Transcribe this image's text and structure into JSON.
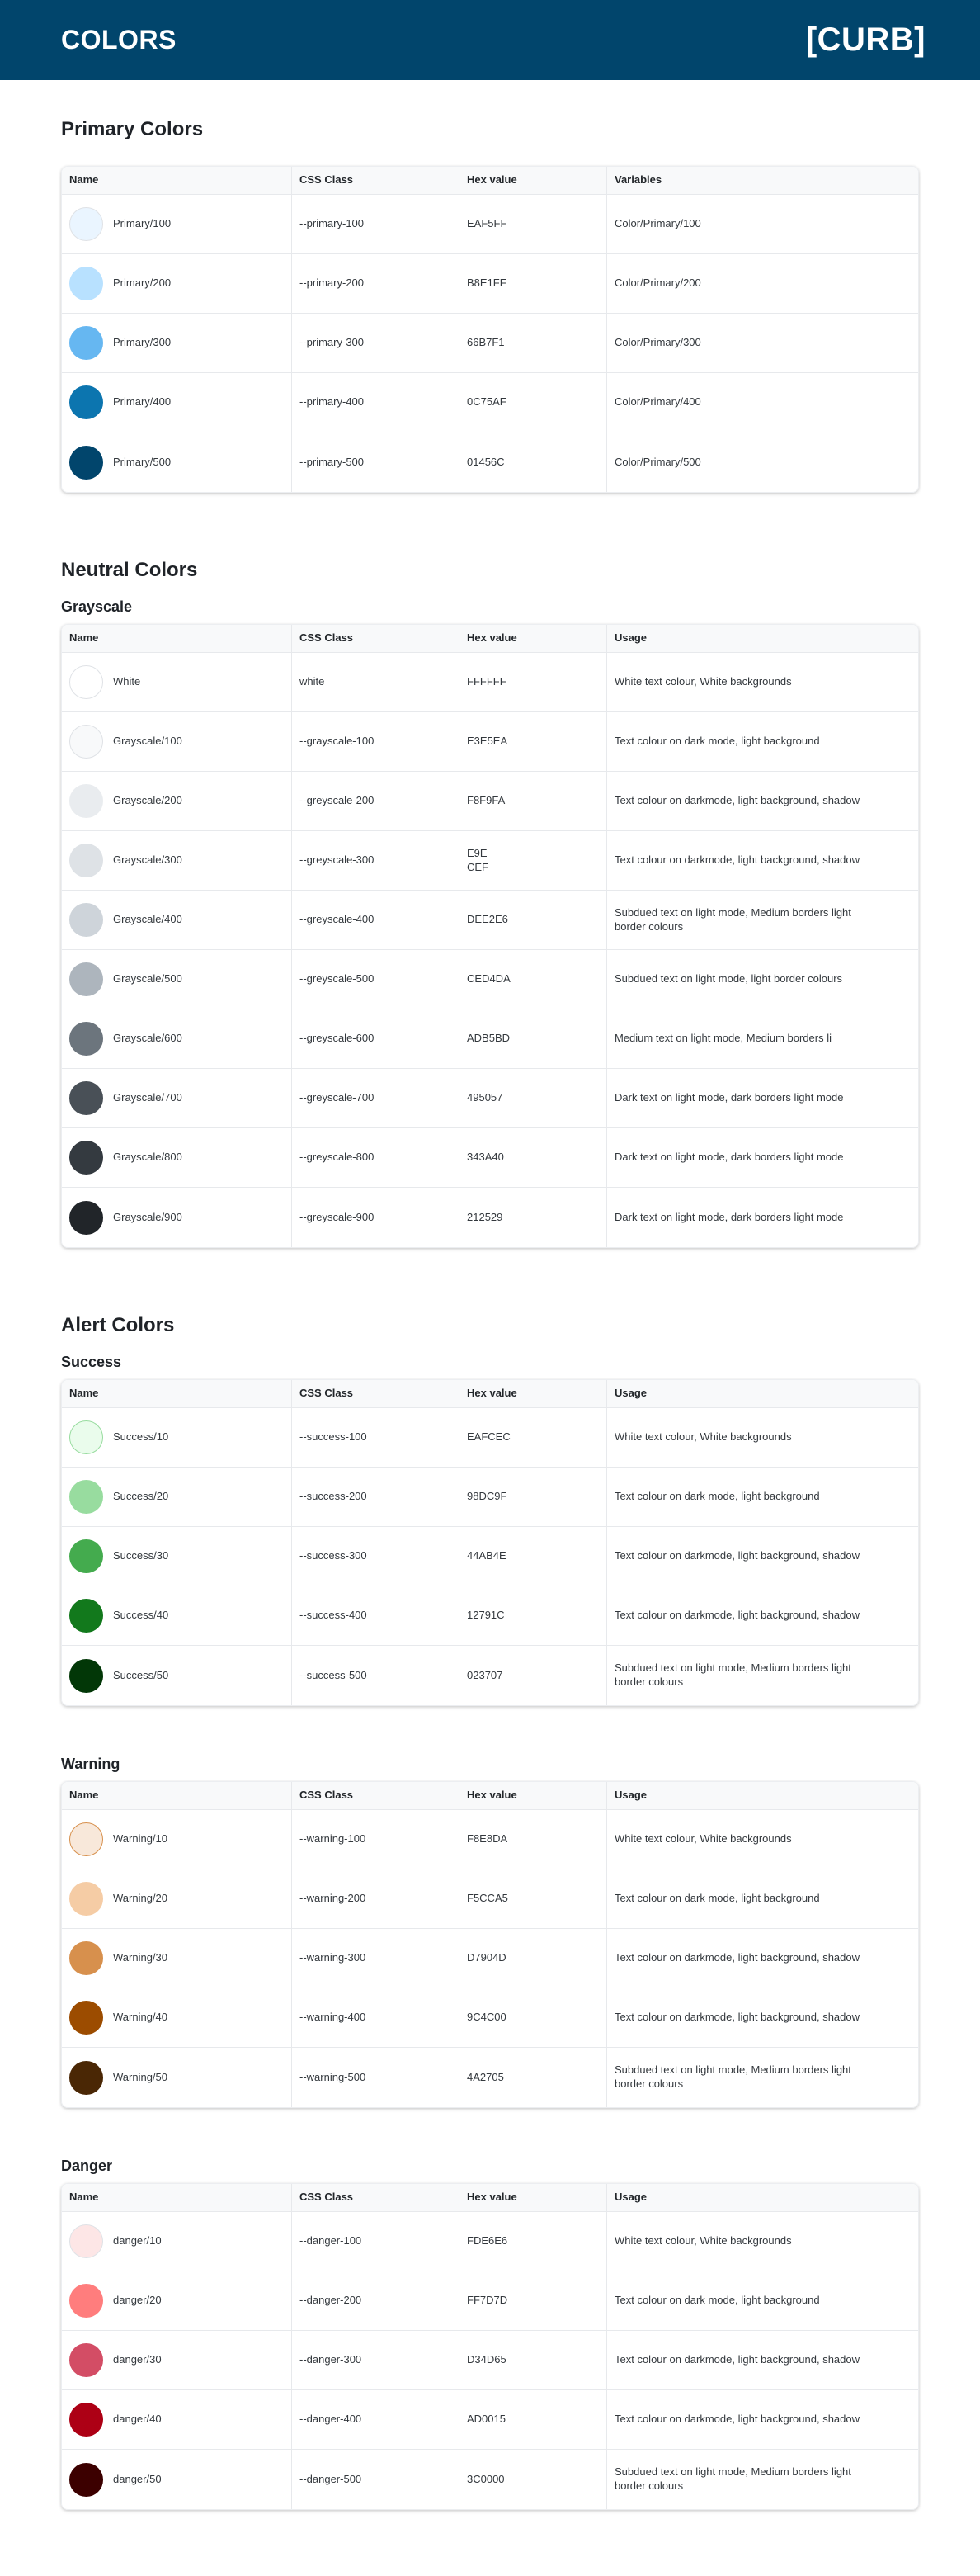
{
  "header": {
    "title": "COLORS",
    "logo": "[CURB]"
  },
  "primary": {
    "title": "Primary Colors",
    "columns": [
      "Name",
      "CSS Class",
      "Hex value",
      "Variables"
    ],
    "rows": [
      {
        "name": "Primary/100",
        "css": "--primary-100",
        "hex": "EAF5FF",
        "extra": "Color/Primary/100",
        "color": "#EAF5FF"
      },
      {
        "name": "Primary/200",
        "css": "--primary-200",
        "hex": "B8E1FF",
        "extra": "Color/Primary/200",
        "color": "#B8E1FF"
      },
      {
        "name": "Primary/300",
        "css": "--primary-300",
        "hex": "66B7F1",
        "extra": "Color/Primary/300",
        "color": "#66B7F1"
      },
      {
        "name": "Primary/400",
        "css": "--primary-400",
        "hex": "0C75AF",
        "extra": "Color/Primary/400",
        "color": "#0C75AF"
      },
      {
        "name": "Primary/500",
        "css": "--primary-500",
        "hex": "01456C",
        "extra": "Color/Primary/500",
        "color": "#01456C"
      }
    ]
  },
  "neutral": {
    "title": "Neutral Colors",
    "subtitle": "Grayscale",
    "columns": [
      "Name",
      "CSS Class",
      "Hex value",
      "Usage"
    ],
    "rows": [
      {
        "name": "White",
        "css": "white",
        "hex": "FFFFFF",
        "extra": "White text colour, White backgrounds",
        "color": "#FFFFFF"
      },
      {
        "name": "Grayscale/100",
        "css": "--grayscale-100",
        "hex": "E3E5EA",
        "extra": "Text colour on dark mode, light background",
        "color": "#F8F9FA"
      },
      {
        "name": "Grayscale/200",
        "css": "--greyscale-200",
        "hex": "F8F9FA",
        "extra": "Text colour on darkmode, light background, shadow",
        "color": "#E9ECEF"
      },
      {
        "name": "Grayscale/300",
        "css": "--greyscale-300",
        "hex": "E9E\nCEF",
        "extra": "Text colour on darkmode, light background, shadow",
        "color": "#DEE2E6"
      },
      {
        "name": "Grayscale/400",
        "css": "--greyscale-400",
        "hex": "DEE2E6",
        "extra": "Subdued text on light mode, Medium borders light border colours",
        "color": "#CED4DA"
      },
      {
        "name": "Grayscale/500",
        "css": "--greyscale-500",
        "hex": "CED4DA",
        "extra": "Subdued text on light mode, light border colours",
        "color": "#ADB5BD"
      },
      {
        "name": "Grayscale/600",
        "css": "--greyscale-600",
        "hex": "ADB5BD",
        "extra": "Medium text on light mode, Medium borders li",
        "color": "#6C757D"
      },
      {
        "name": "Grayscale/700",
        "css": "--greyscale-700",
        "hex": "495057",
        "extra": "Dark text on light mode, dark borders light mode",
        "color": "#495057"
      },
      {
        "name": "Grayscale/800",
        "css": "--greyscale-800",
        "hex": "343A40",
        "extra": "Dark text on light mode, dark borders light mode",
        "color": "#343A40"
      },
      {
        "name": "Grayscale/900",
        "css": "--greyscale-900",
        "hex": "212529",
        "extra": "Dark text on light mode, dark borders light mode",
        "color": "#212529"
      }
    ]
  },
  "alert": {
    "title": "Alert Colors",
    "success": {
      "subtitle": "Success",
      "columns": [
        "Name",
        "CSS Class",
        "Hex value",
        "Usage"
      ],
      "rows": [
        {
          "name": "Success/10",
          "css": "--success-100",
          "hex": "EAFCEC",
          "extra": "White text colour, White backgrounds",
          "color": "#EAFCEC",
          "border": "#98DC9F"
        },
        {
          "name": "Success/20",
          "css": "--success-200",
          "hex": "98DC9F",
          "extra": "Text colour on dark mode, light background",
          "color": "#98DC9F"
        },
        {
          "name": "Success/30",
          "css": "--success-300",
          "hex": "44AB4E",
          "extra": "Text colour on darkmode, light background, shadow",
          "color": "#44AB4E"
        },
        {
          "name": "Success/40",
          "css": "--success-400",
          "hex": "12791C",
          "extra": "Text colour on darkmode, light background, shadow",
          "color": "#12791C"
        },
        {
          "name": "Success/50",
          "css": "--success-500",
          "hex": "023707",
          "extra": "Subdued text on light mode, Medium borders light border colours",
          "color": "#023707"
        }
      ]
    },
    "warning": {
      "subtitle": "Warning",
      "columns": [
        "Name",
        "CSS Class",
        "Hex value",
        "Usage"
      ],
      "rows": [
        {
          "name": "Warning/10",
          "css": "--warning-100",
          "hex": "F8E8DA",
          "extra": "White text colour, White backgrounds",
          "color": "#F8E8DA",
          "border": "#D7904D"
        },
        {
          "name": "Warning/20",
          "css": "--warning-200",
          "hex": "F5CCA5",
          "extra": "Text colour on dark mode, light background",
          "color": "#F5CCA5"
        },
        {
          "name": "Warning/30",
          "css": "--warning-300",
          "hex": "D7904D",
          "extra": "Text colour on darkmode, light background, shadow",
          "color": "#D7904D"
        },
        {
          "name": "Warning/40",
          "css": "--warning-400",
          "hex": "9C4C00",
          "extra": "Text colour on darkmode, light background, shadow",
          "color": "#9C4C00"
        },
        {
          "name": "Warning/50",
          "css": "--warning-500",
          "hex": "4A2705",
          "extra": "Subdued text on light mode, Medium borders light border colours",
          "color": "#4A2705"
        }
      ]
    },
    "danger": {
      "subtitle": "Danger",
      "columns": [
        "Name",
        "CSS Class",
        "Hex value",
        "Usage"
      ],
      "rows": [
        {
          "name": "danger/10",
          "css": "--danger-100",
          "hex": "FDE6E6",
          "extra": "White text colour, White backgrounds",
          "color": "#FDE6E6"
        },
        {
          "name": "danger/20",
          "css": "--danger-200",
          "hex": "FF7D7D",
          "extra": "Text colour on dark mode, light background",
          "color": "#FF7D7D"
        },
        {
          "name": "danger/30",
          "css": "--danger-300",
          "hex": "D34D65",
          "extra": "Text colour on darkmode, light background, shadow",
          "color": "#D34D65"
        },
        {
          "name": "danger/40",
          "css": "--danger-400",
          "hex": "AD0015",
          "extra": "Text colour on darkmode, light background, shadow",
          "color": "#AD0015"
        },
        {
          "name": "danger/50",
          "css": "--danger-500",
          "hex": "3C0000",
          "extra": "Subdued text on light mode, Medium borders light border colours",
          "color": "#3C0000"
        }
      ]
    }
  }
}
